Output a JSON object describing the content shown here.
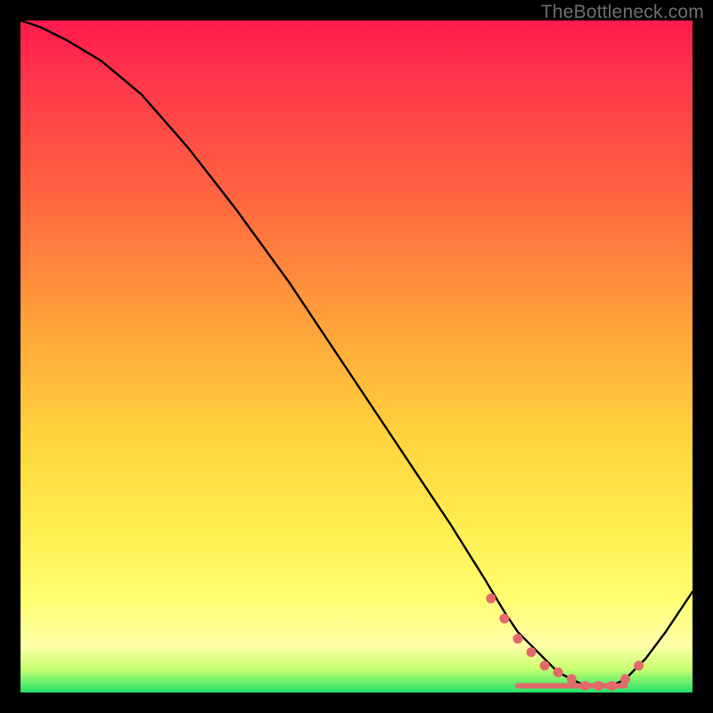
{
  "watermark": "TheBottleneck.com",
  "palette": {
    "curve_stroke": "#000000",
    "marker_fill": "#e46a6a",
    "marker_stroke": "#e46a6a",
    "gradient_stops": [
      "#ff1a4d",
      "#ff3a4a",
      "#ff6a3e",
      "#ffa23a",
      "#ffd43c",
      "#ffee50",
      "#ffff70",
      "#ffffa8",
      "#c8ff70",
      "#23e26a"
    ]
  },
  "chart_data": {
    "type": "line",
    "title": "",
    "xlabel": "",
    "ylabel": "",
    "xlim": [
      0,
      100
    ],
    "ylim": [
      0,
      100
    ],
    "series": [
      {
        "name": "bottleneck-curve",
        "x": [
          0,
          3,
          7,
          12,
          18,
          25,
          32,
          40,
          48,
          56,
          60,
          64,
          69,
          72,
          74,
          76,
          78,
          80,
          82,
          84,
          86,
          88,
          90,
          93,
          96,
          100
        ],
        "y": [
          100,
          99,
          97,
          94,
          89,
          81,
          72,
          61,
          49,
          37,
          31,
          25,
          17,
          12,
          9,
          7,
          5,
          3,
          2,
          1,
          1,
          1,
          2,
          5,
          9,
          15
        ]
      }
    ],
    "markers": {
      "name": "highlight-dots",
      "x": [
        70,
        72,
        74,
        76,
        78,
        80,
        82,
        84,
        86,
        88,
        90,
        92
      ],
      "y": [
        14,
        11,
        8,
        6,
        4,
        3,
        2,
        1,
        1,
        1,
        2,
        4
      ]
    },
    "flat_trough": {
      "x_start": 74,
      "x_end": 90,
      "y": 1,
      "thickness": 6
    }
  }
}
